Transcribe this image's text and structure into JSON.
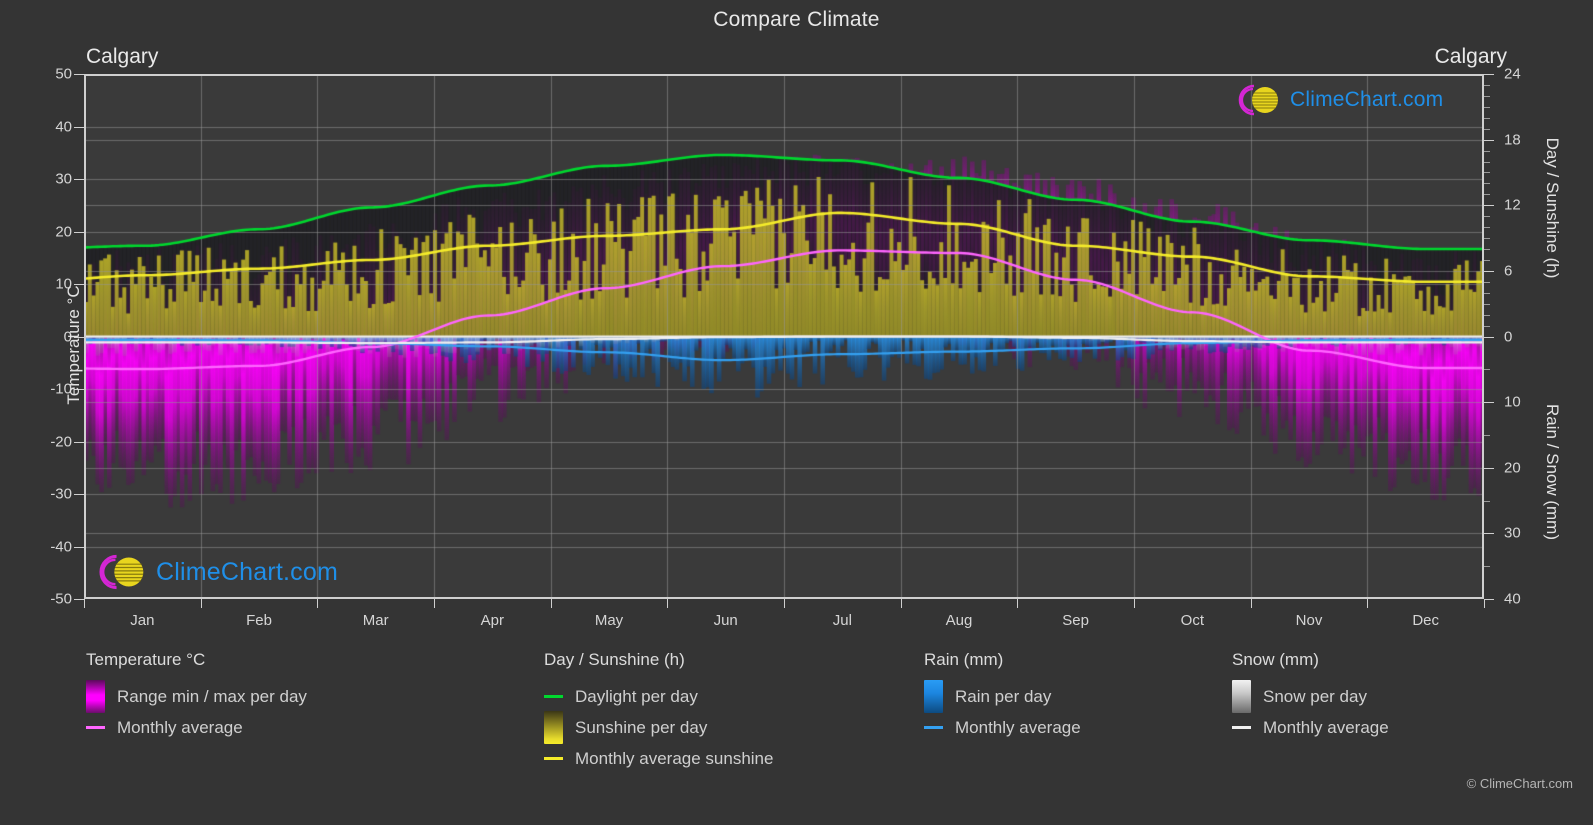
{
  "header": {
    "title": "Compare Climate",
    "city_left": "Calgary",
    "city_right": "Calgary"
  },
  "watermark": {
    "text": "ClimeChart.com",
    "ring_color": "#d426d4",
    "sphere_color": "#e8d51e",
    "text_color": "#1f8fe8"
  },
  "footer": {
    "copyright": "© ClimeChart.com"
  },
  "axes": {
    "left_label": "Temperature °C",
    "right_label_top": "Day / Sunshine (h)",
    "right_label_bottom": "Rain / Snow (mm)",
    "left_ticks": [
      "50",
      "40",
      "30",
      "20",
      "10",
      "0",
      "-10",
      "-20",
      "-30",
      "-40",
      "-50"
    ],
    "right_ticks_top": [
      "24",
      "18",
      "12",
      "6",
      "0"
    ],
    "right_ticks_bottom": [
      "0",
      "10",
      "20",
      "30",
      "40"
    ],
    "x_ticks": [
      "Jan",
      "Feb",
      "Mar",
      "Apr",
      "May",
      "Jun",
      "Jul",
      "Aug",
      "Sep",
      "Oct",
      "Nov",
      "Dec"
    ]
  },
  "legend": {
    "temperature": {
      "heading": "Temperature °C",
      "items": [
        {
          "label": "Range min / max per day",
          "swatch": "gradient-magenta",
          "color": "#ff00ff"
        },
        {
          "label": "Monthly average",
          "swatch": "line",
          "color": "#ff66ff"
        }
      ]
    },
    "day_sunshine": {
      "heading": "Day / Sunshine (h)",
      "items": [
        {
          "label": "Daylight per day",
          "swatch": "line",
          "color": "#00d82e"
        },
        {
          "label": "Sunshine per day",
          "swatch": "gradient-yellow",
          "color": "#f5ec2a"
        },
        {
          "label": "Monthly average sunshine",
          "swatch": "line",
          "color": "#f5ec2a"
        }
      ]
    },
    "rain": {
      "heading": "Rain (mm)",
      "items": [
        {
          "label": "Rain per day",
          "swatch": "gradient-blue",
          "color": "#1c86e0"
        },
        {
          "label": "Monthly average",
          "swatch": "line",
          "color": "#34a0f0"
        }
      ]
    },
    "snow": {
      "heading": "Snow (mm)",
      "items": [
        {
          "label": "Snow per day",
          "swatch": "gradient-white",
          "color": "#e6e6e6"
        },
        {
          "label": "Monthly average",
          "swatch": "line",
          "color": "#f0f0f0"
        }
      ]
    }
  },
  "chart_data": {
    "type": "line",
    "title": "Compare Climate",
    "subtitle": "Calgary",
    "xlabel": "",
    "ylabel": "Temperature °C",
    "ylabel_right_top": "Day / Sunshine (h)",
    "ylabel_right_bottom": "Rain / Snow (mm)",
    "ylim": [
      -50,
      50
    ],
    "ylim_right_top": [
      0,
      24
    ],
    "ylim_right_bottom": [
      0,
      40
    ],
    "grid": true,
    "legend_position": "below",
    "categories": [
      "Jan",
      "Feb",
      "Mar",
      "Apr",
      "May",
      "Jun",
      "Jul",
      "Aug",
      "Sep",
      "Oct",
      "Nov",
      "Dec"
    ],
    "series": [
      {
        "name": "Daylight per day",
        "unit": "h",
        "axis": "right-top",
        "color": "#00d82e",
        "values": [
          8.3,
          9.8,
          11.8,
          13.8,
          15.6,
          16.6,
          16.1,
          14.5,
          12.5,
          10.5,
          8.8,
          8.0
        ]
      },
      {
        "name": "Monthly average sunshine",
        "unit": "h",
        "axis": "right-top",
        "color": "#f5ec2a",
        "values": [
          5.6,
          6.2,
          7.0,
          8.3,
          9.2,
          9.8,
          11.3,
          10.3,
          8.3,
          7.3,
          5.5,
          5.0
        ]
      },
      {
        "name": "Monthly average temperature",
        "unit": "°C",
        "axis": "left",
        "color": "#ff66ff",
        "values": [
          -6.2,
          -5.6,
          -2.0,
          4.0,
          9.2,
          13.4,
          16.4,
          15.9,
          10.8,
          4.6,
          -2.7,
          -6.0
        ]
      },
      {
        "name": "Temperature range min / max per day",
        "unit": "°C",
        "axis": "left",
        "color": "#ff00ff",
        "max_values": [
          12.0,
          13.5,
          17.0,
          23.0,
          27.0,
          30.0,
          31.5,
          31.0,
          27.0,
          22.0,
          15.0,
          11.5
        ],
        "min_values": [
          -26.0,
          -25.0,
          -20.0,
          -11.0,
          -4.0,
          1.0,
          5.0,
          3.0,
          -3.0,
          -11.0,
          -20.0,
          -25.0
        ]
      },
      {
        "name": "Rain monthly average",
        "unit": "mm",
        "axis": "right-bottom",
        "color": "#34a0f0",
        "values": [
          0.5,
          0.6,
          1.0,
          1.5,
          2.4,
          3.6,
          2.7,
          2.3,
          1.8,
          1.0,
          0.6,
          0.5
        ]
      },
      {
        "name": "Snow monthly average",
        "unit": "mm",
        "axis": "right-bottom",
        "color": "#f0f0f0",
        "values": [
          0.9,
          0.9,
          1.0,
          0.9,
          0.4,
          0.1,
          0.0,
          0.0,
          0.2,
          0.7,
          0.9,
          0.9
        ]
      }
    ]
  }
}
